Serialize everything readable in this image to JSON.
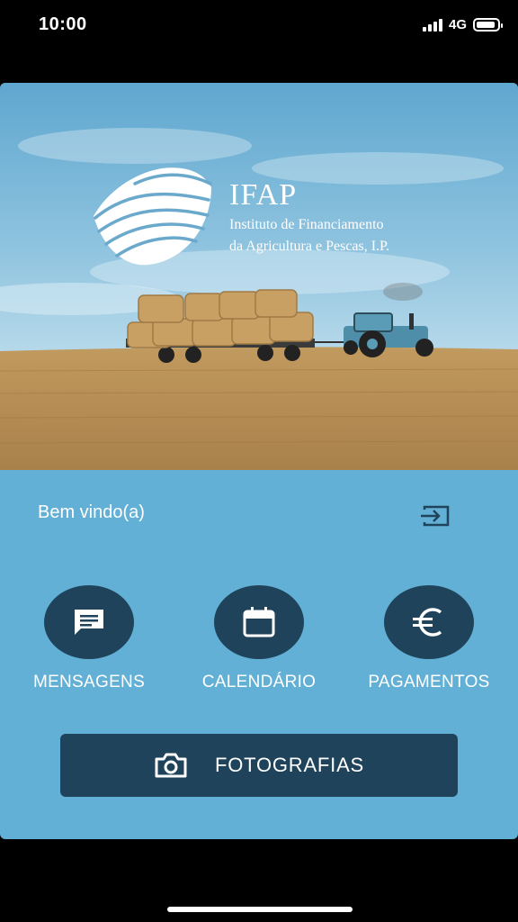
{
  "status_bar": {
    "time": "10:00",
    "network": "4G",
    "battery_level": 0.9
  },
  "brand": {
    "name": "IFAP",
    "subtitle_line1": "Instituto de Financiamento",
    "subtitle_line2": "da Agricultura e Pescas, I.P."
  },
  "welcome_text": "Bem vindo(a)",
  "actions": [
    {
      "label": "MENSAGENS",
      "icon": "message-icon"
    },
    {
      "label": "CALENDÁRIO",
      "icon": "calendar-icon"
    },
    {
      "label": "PAGAMENTOS",
      "icon": "euro-icon"
    }
  ],
  "photos_button": {
    "label": "FOTOGRAFIAS",
    "icon": "camera-icon"
  },
  "colors": {
    "background": "#63b0d6",
    "button": "#1f435a",
    "text": "#ffffff"
  }
}
